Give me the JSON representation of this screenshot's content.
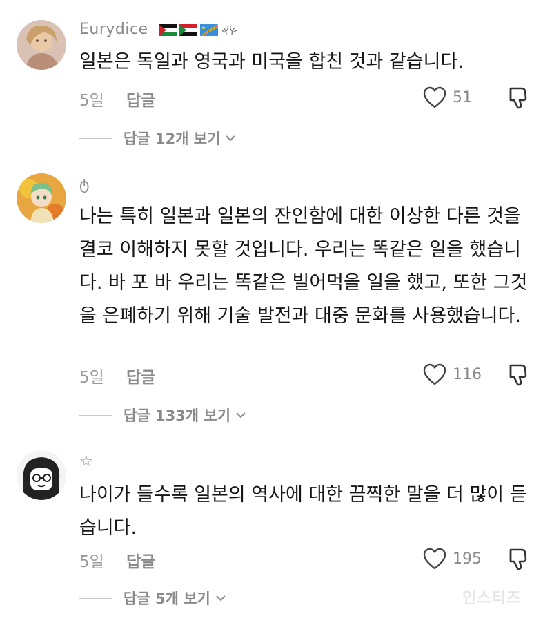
{
  "comments": [
    {
      "username": "Eurydice",
      "text": "일본은 독일과 영국과 미국을 합친 것과 같습니다.",
      "time": "5일",
      "reply_label": "답글",
      "likes": "51",
      "view_replies": "답글 12개 보기"
    },
    {
      "username": "ტ",
      "text": "나는 특히 일본과 일본의 잔인함에 대한 이상한 다른 것을 결코 이해하지 못할 것입니다. 우리는 똑같은 일을 했습니다. 바 포 바 우리는 똑같은 빌어먹을 일을 했고, 또한 그것을 은폐하기 위해 기술 발전과 대중 문화를 사용했습니다.",
      "time": "5일",
      "reply_label": "답글",
      "likes": "116",
      "view_replies": "답글 133개 보기"
    },
    {
      "username": "☆",
      "text": "나이가 들수록 일본의 역사에 대한 끔찍한 말을 더 많이 듣습니다.",
      "time": "5일",
      "reply_label": "답글",
      "likes": "195",
      "view_replies": "답글 5개 보기"
    }
  ],
  "watermark": "인스티즈",
  "icons": {
    "like": "heart-outline-icon",
    "dislike": "thumbs-down-outline-icon",
    "expand": "chevron-down-icon"
  },
  "colors": {
    "text": "#161616",
    "muted": "#8a8a8a",
    "icon": "#444444"
  }
}
